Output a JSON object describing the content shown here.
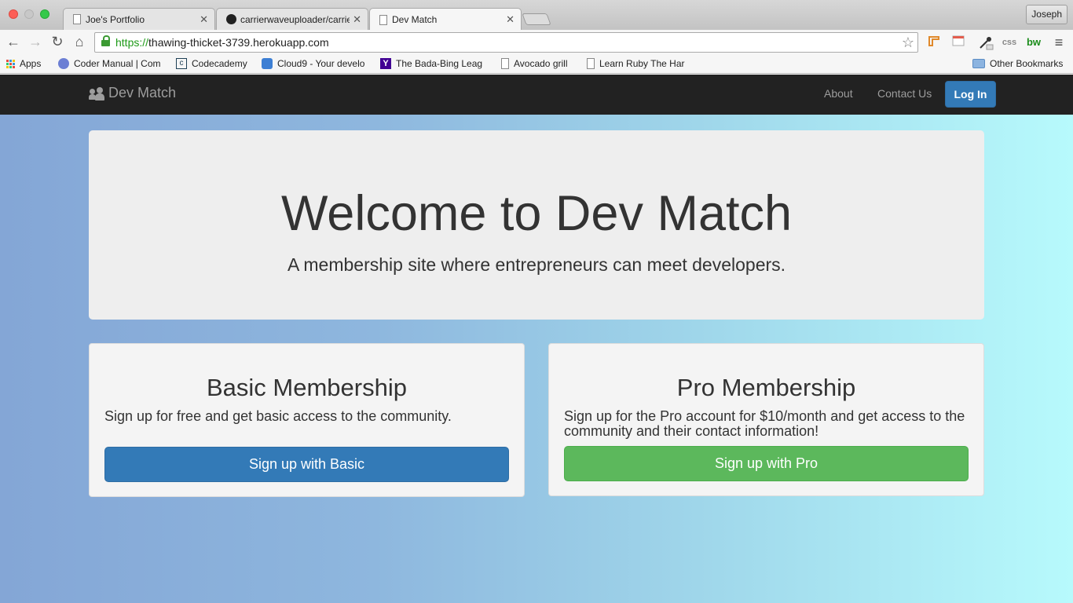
{
  "browser": {
    "tabs": [
      {
        "title": "Joe's Portfolio",
        "icon": "document-icon",
        "active": false
      },
      {
        "title": "carrierwaveuploader/carrierwave",
        "icon": "github-icon",
        "active": false
      },
      {
        "title": "Dev Match",
        "icon": "document-icon",
        "active": true
      }
    ],
    "profile_name": "Joseph",
    "address": {
      "scheme": "https://",
      "host": "thawing-thicket-3739.herokuapp.com"
    },
    "extensions": [
      "css",
      "bw"
    ],
    "bookmarks": [
      {
        "label": "Apps",
        "icon": "apps-grid-icon"
      },
      {
        "label": "Coder Manual | Com",
        "icon": "codermanual-icon"
      },
      {
        "label": "Codecademy",
        "icon": "codecademy-icon"
      },
      {
        "label": "Cloud9 - Your develo",
        "icon": "cloud9-icon"
      },
      {
        "label": "The Bada-Bing Leag",
        "icon": "yahoo-icon"
      },
      {
        "label": "Avocado grill",
        "icon": "document-icon"
      },
      {
        "label": "Learn Ruby The Har",
        "icon": "document-icon"
      }
    ],
    "other_bookmarks": "Other Bookmarks"
  },
  "site": {
    "brand": "Dev Match",
    "nav": {
      "about": "About",
      "contact": "Contact Us",
      "login": "Log In"
    },
    "hero": {
      "title": "Welcome to Dev Match",
      "subtitle": "A membership site where entrepreneurs can meet developers."
    },
    "plans": {
      "basic": {
        "title": "Basic Membership",
        "description": "Sign up for free and get basic access to the community.",
        "button": "Sign up with Basic"
      },
      "pro": {
        "title": "Pro Membership",
        "description": "Sign up for the Pro account for $10/month and get access to the community and their contact information!",
        "button": "Sign up with Pro"
      }
    }
  },
  "colors": {
    "navbar": "#222222",
    "primary": "#337ab7",
    "success": "#5cb85c",
    "jumbotron": "#eeeeee"
  }
}
